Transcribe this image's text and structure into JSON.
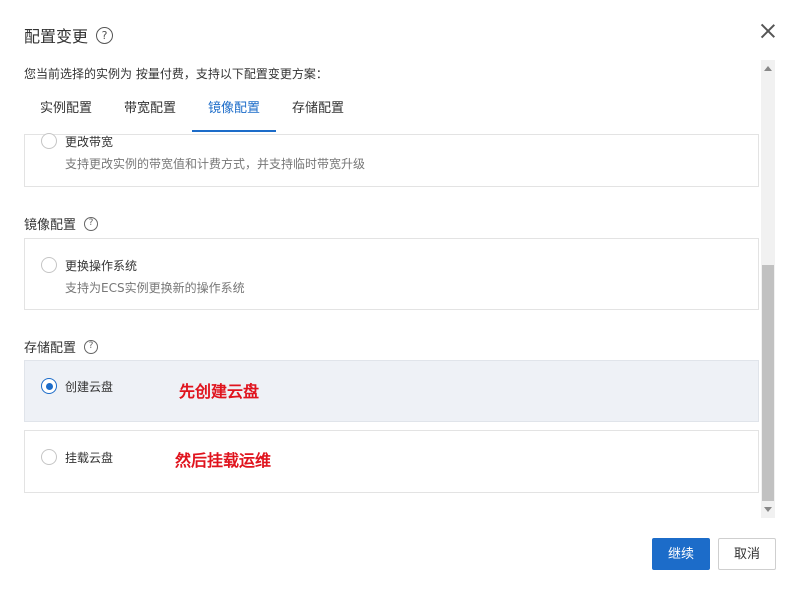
{
  "dialog": {
    "title": "配置变更",
    "help_icon": "question-circle-icon",
    "close_icon": "close-icon"
  },
  "description": "您当前选择的实例为 按量付费，支持以下配置变更方案：",
  "tabs": [
    {
      "label": "实例配置",
      "active": false
    },
    {
      "label": "带宽配置",
      "active": false
    },
    {
      "label": "镜像配置",
      "active": true
    },
    {
      "label": "存储配置",
      "active": false
    }
  ],
  "bandwidth_option": {
    "title": "更改带宽",
    "desc": "支持更改实例的带宽值和计费方式，并支持临时带宽升级",
    "selected": false
  },
  "image_section": {
    "label": "镜像配置",
    "option": {
      "title": "更换操作系统",
      "desc": "支持为ECS实例更换新的操作系统",
      "selected": false
    }
  },
  "storage_section": {
    "label": "存储配置",
    "options": [
      {
        "title": "创建云盘",
        "annotation": "先创建云盘",
        "selected": true
      },
      {
        "title": "挂载云盘",
        "annotation": "然后挂载运维",
        "selected": false
      }
    ]
  },
  "footer": {
    "continue_label": "继续",
    "cancel_label": "取消"
  },
  "colors": {
    "accent": "#1c6cc9",
    "annotation": "#e0141e",
    "selected_bg": "#eef1f6"
  }
}
